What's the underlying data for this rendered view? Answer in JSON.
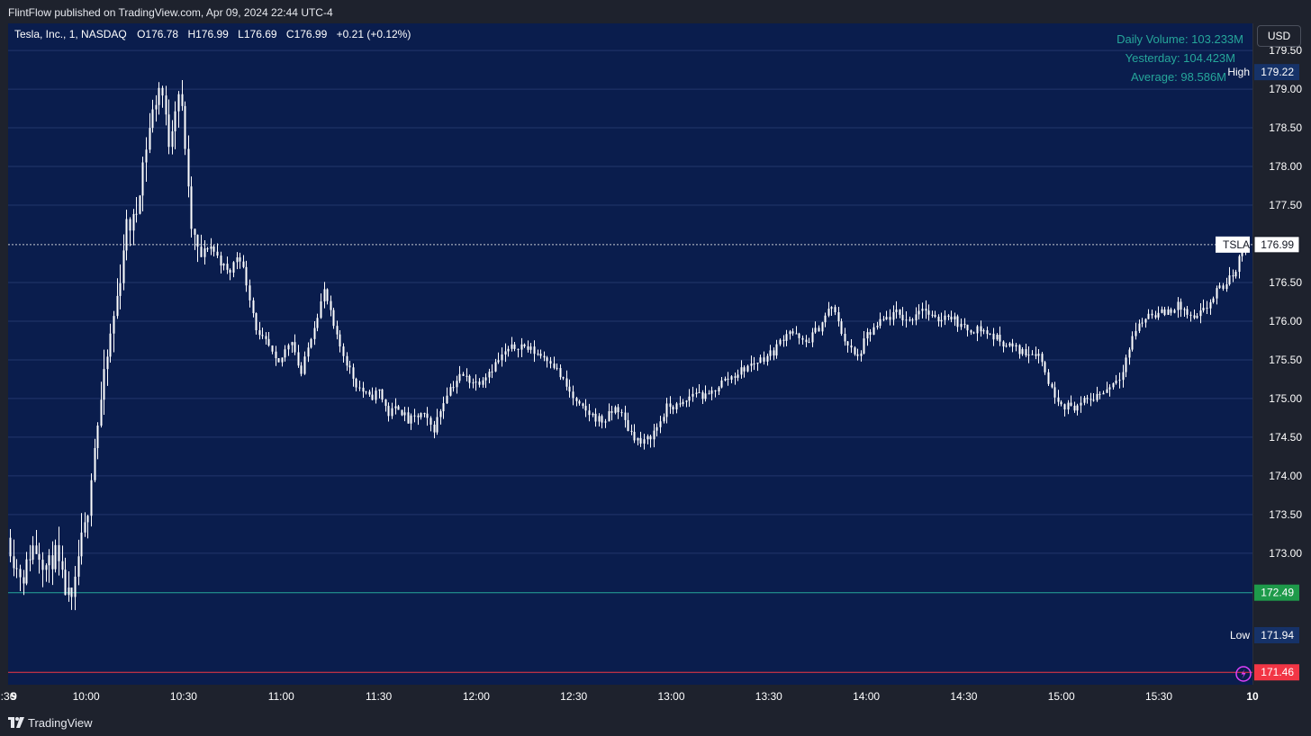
{
  "header": {
    "published": "FlintFlow published on TradingView.com, Apr 09, 2024 22:44 UTC-4",
    "currency": "USD"
  },
  "footer": {
    "brand": "TradingView"
  },
  "colors": {
    "background": "#1e222d",
    "plot_background": "#0a1d4d",
    "candle": "#ffffff",
    "line_green": "#26a69a",
    "line_red": "#f23645",
    "label_blue": "#163268",
    "label_green": "#1e9a4a",
    "label_red": "#f23645"
  },
  "chart_data": {
    "type": "candlestick",
    "title": "Tesla, Inc., 1, NASDAQ",
    "ohlc": {
      "O": "176.78",
      "H": "176.99",
      "L": "176.69",
      "C": "176.99",
      "change": "+0.21 (+0.12%)"
    },
    "volume_info": {
      "daily": "Daily Volume: 103.233M",
      "yesterday": "Yesterday: 104.423M",
      "average": "Average: 98.586M"
    },
    "y_axis": {
      "ticks": [
        "179.50",
        "179.00",
        "178.50",
        "178.00",
        "177.50",
        "176.50",
        "176.00",
        "175.50",
        "175.00",
        "174.50",
        "174.00",
        "173.50",
        "173.00"
      ],
      "range": [
        171.3,
        179.85
      ]
    },
    "x_axis": {
      "ticks": [
        ":36",
        "9",
        "10:00",
        "10:30",
        "11:00",
        "11:30",
        "12:00",
        "12:30",
        "13:00",
        "13:30",
        "14:00",
        "14:30",
        "15:00",
        "15:30",
        "10"
      ],
      "tick_times": [
        9.6,
        9.63,
        10.0,
        10.5,
        11.0,
        11.5,
        12.0,
        12.5,
        13.0,
        13.5,
        14.0,
        14.5,
        15.0,
        15.5,
        15.98
      ],
      "range_hours": [
        9.6,
        15.98
      ]
    },
    "price_labels": [
      {
        "tag": "High",
        "value": "179.22",
        "price": 179.22,
        "style": "blue"
      },
      {
        "tag": "TSLA",
        "value": "176.99",
        "price": 176.99,
        "style": "last"
      },
      {
        "tag": "",
        "value": "172.49",
        "price": 172.49,
        "style": "green"
      },
      {
        "tag": "Low",
        "value": "171.94",
        "price": 171.94,
        "style": "blue"
      },
      {
        "tag": "",
        "value": "171.46",
        "price": 171.46,
        "style": "red"
      }
    ],
    "horizontal_lines": [
      {
        "price": 176.99,
        "style": "dotted",
        "color": "#c8cbd3"
      },
      {
        "price": 172.49,
        "style": "solid",
        "color": "#26a69a"
      },
      {
        "price": 171.46,
        "style": "solid",
        "color": "#f23645"
      }
    ],
    "price_path": [
      [
        9.6,
        173.2
      ],
      [
        9.64,
        172.8
      ],
      [
        9.68,
        172.7
      ],
      [
        9.72,
        173.1
      ],
      [
        9.76,
        173.0
      ],
      [
        9.8,
        172.8
      ],
      [
        9.84,
        173.0
      ],
      [
        9.88,
        172.6
      ],
      [
        9.93,
        172.3
      ],
      [
        9.96,
        173.0
      ],
      [
        10.0,
        173.4
      ],
      [
        10.03,
        174.2
      ],
      [
        10.07,
        174.9
      ],
      [
        10.1,
        175.4
      ],
      [
        10.13,
        175.9
      ],
      [
        10.17,
        176.5
      ],
      [
        10.2,
        177.2
      ],
      [
        10.25,
        177.3
      ],
      [
        10.28,
        177.9
      ],
      [
        10.33,
        178.6
      ],
      [
        10.38,
        179.1
      ],
      [
        10.42,
        178.3
      ],
      [
        10.47,
        179.0
      ],
      [
        10.5,
        178.5
      ],
      [
        10.53,
        177.3
      ],
      [
        10.58,
        176.8
      ],
      [
        10.63,
        177.0
      ],
      [
        10.68,
        176.8
      ],
      [
        10.73,
        176.6
      ],
      [
        10.78,
        176.9
      ],
      [
        10.83,
        176.4
      ],
      [
        10.88,
        175.8
      ],
      [
        10.93,
        175.7
      ],
      [
        10.98,
        175.4
      ],
      [
        11.05,
        175.8
      ],
      [
        11.1,
        175.3
      ],
      [
        11.15,
        175.8
      ],
      [
        11.22,
        176.4
      ],
      [
        11.28,
        175.8
      ],
      [
        11.33,
        175.5
      ],
      [
        11.38,
        175.2
      ],
      [
        11.45,
        175.0
      ],
      [
        11.5,
        175.1
      ],
      [
        11.55,
        174.8
      ],
      [
        11.6,
        174.9
      ],
      [
        11.65,
        174.7
      ],
      [
        11.72,
        174.8
      ],
      [
        11.78,
        174.6
      ],
      [
        11.85,
        175.1
      ],
      [
        11.92,
        175.3
      ],
      [
        12.0,
        175.2
      ],
      [
        12.08,
        175.4
      ],
      [
        12.15,
        175.6
      ],
      [
        12.22,
        175.7
      ],
      [
        12.3,
        175.6
      ],
      [
        12.38,
        175.5
      ],
      [
        12.45,
        175.2
      ],
      [
        12.52,
        174.9
      ],
      [
        12.58,
        174.8
      ],
      [
        12.65,
        174.7
      ],
      [
        12.72,
        174.9
      ],
      [
        12.78,
        174.6
      ],
      [
        12.85,
        174.4
      ],
      [
        12.92,
        174.6
      ],
      [
        12.98,
        174.9
      ],
      [
        13.05,
        174.9
      ],
      [
        13.12,
        175.1
      ],
      [
        13.18,
        175.0
      ],
      [
        13.25,
        175.2
      ],
      [
        13.32,
        175.3
      ],
      [
        13.38,
        175.4
      ],
      [
        13.45,
        175.5
      ],
      [
        13.52,
        175.6
      ],
      [
        13.6,
        175.9
      ],
      [
        13.68,
        175.7
      ],
      [
        13.75,
        175.9
      ],
      [
        13.82,
        176.2
      ],
      [
        13.88,
        175.8
      ],
      [
        13.95,
        175.5
      ],
      [
        14.0,
        175.8
      ],
      [
        14.08,
        176.0
      ],
      [
        14.15,
        176.1
      ],
      [
        14.22,
        176.0
      ],
      [
        14.28,
        176.2
      ],
      [
        14.35,
        176.0
      ],
      [
        14.42,
        176.1
      ],
      [
        14.5,
        175.9
      ],
      [
        14.58,
        175.9
      ],
      [
        14.65,
        175.8
      ],
      [
        14.72,
        175.7
      ],
      [
        14.8,
        175.6
      ],
      [
        14.88,
        175.6
      ],
      [
        14.95,
        175.1
      ],
      [
        15.02,
        174.9
      ],
      [
        15.08,
        174.9
      ],
      [
        15.15,
        175.0
      ],
      [
        15.22,
        175.1
      ],
      [
        15.3,
        175.3
      ],
      [
        15.38,
        175.9
      ],
      [
        15.45,
        176.1
      ],
      [
        15.52,
        176.1
      ],
      [
        15.6,
        176.2
      ],
      [
        15.68,
        176.0
      ],
      [
        15.75,
        176.2
      ],
      [
        15.8,
        176.4
      ],
      [
        15.85,
        176.5
      ],
      [
        15.9,
        176.7
      ],
      [
        15.93,
        176.99
      ]
    ]
  }
}
